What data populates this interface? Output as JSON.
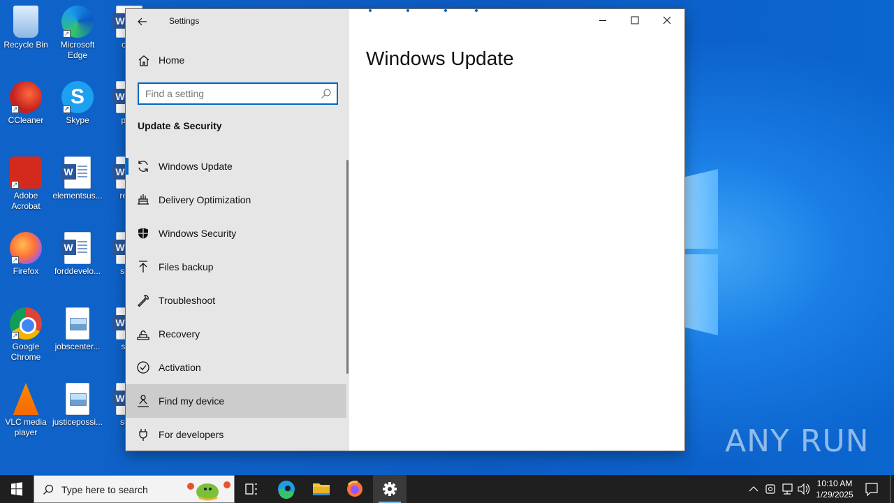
{
  "desktop": {
    "icons": [
      {
        "label": "Recycle Bin",
        "type": "recycle"
      },
      {
        "label": "Microsoft Edge",
        "type": "edge"
      },
      {
        "label": "offic",
        "type": "word"
      },
      {
        "label": "CCleaner",
        "type": "ccleaner"
      },
      {
        "label": "Skype",
        "type": "skype"
      },
      {
        "label": "prov",
        "type": "word"
      },
      {
        "label": "Adobe Acrobat",
        "type": "acrobat"
      },
      {
        "label": "elementsus...",
        "type": "word"
      },
      {
        "label": "recor",
        "type": "word"
      },
      {
        "label": "Firefox",
        "type": "firefox"
      },
      {
        "label": "forddevelo...",
        "type": "word"
      },
      {
        "label": "sprin",
        "type": "word"
      },
      {
        "label": "Google Chrome",
        "type": "chrome"
      },
      {
        "label": "jobscenter...",
        "type": "image"
      },
      {
        "label": "start",
        "type": "word"
      },
      {
        "label": "VLC media player",
        "type": "vlc"
      },
      {
        "label": "justicepossi...",
        "type": "image"
      },
      {
        "label": "supe",
        "type": "word"
      }
    ],
    "watermark": "ANY RUN"
  },
  "settings": {
    "app_title": "Settings",
    "home_label": "Home",
    "search_placeholder": "Find a setting",
    "section_title": "Update & Security",
    "nav_items": [
      {
        "label": "Windows Update",
        "icon": "sync-icon"
      },
      {
        "label": "Delivery Optimization",
        "icon": "delivery-optimization-icon"
      },
      {
        "label": "Windows Security",
        "icon": "shield-icon"
      },
      {
        "label": "Files backup",
        "icon": "upload-arrow-icon"
      },
      {
        "label": "Troubleshoot",
        "icon": "wrench-icon"
      },
      {
        "label": "Recovery",
        "icon": "recovery-icon"
      },
      {
        "label": "Activation",
        "icon": "check-circle-icon"
      },
      {
        "label": "Find my device",
        "icon": "person-location-icon"
      },
      {
        "label": "For developers",
        "icon": "developer-icon"
      }
    ],
    "selected_index": 0,
    "hover_index": 7,
    "page_title": "Windows Update"
  },
  "taskbar": {
    "search_text": "Type here to search",
    "apps": [
      "task-view-icon",
      "edge-icon",
      "file-explorer-icon",
      "firefox-icon",
      "settings-gear-icon"
    ],
    "time": "10:10 AM",
    "date": "1/29/2025"
  },
  "colors": {
    "accent": "#0067c0",
    "sidebar_bg": "#e6e6e6",
    "hover_bg": "#cccccc",
    "taskbar_bg": "#1f1f1f"
  }
}
